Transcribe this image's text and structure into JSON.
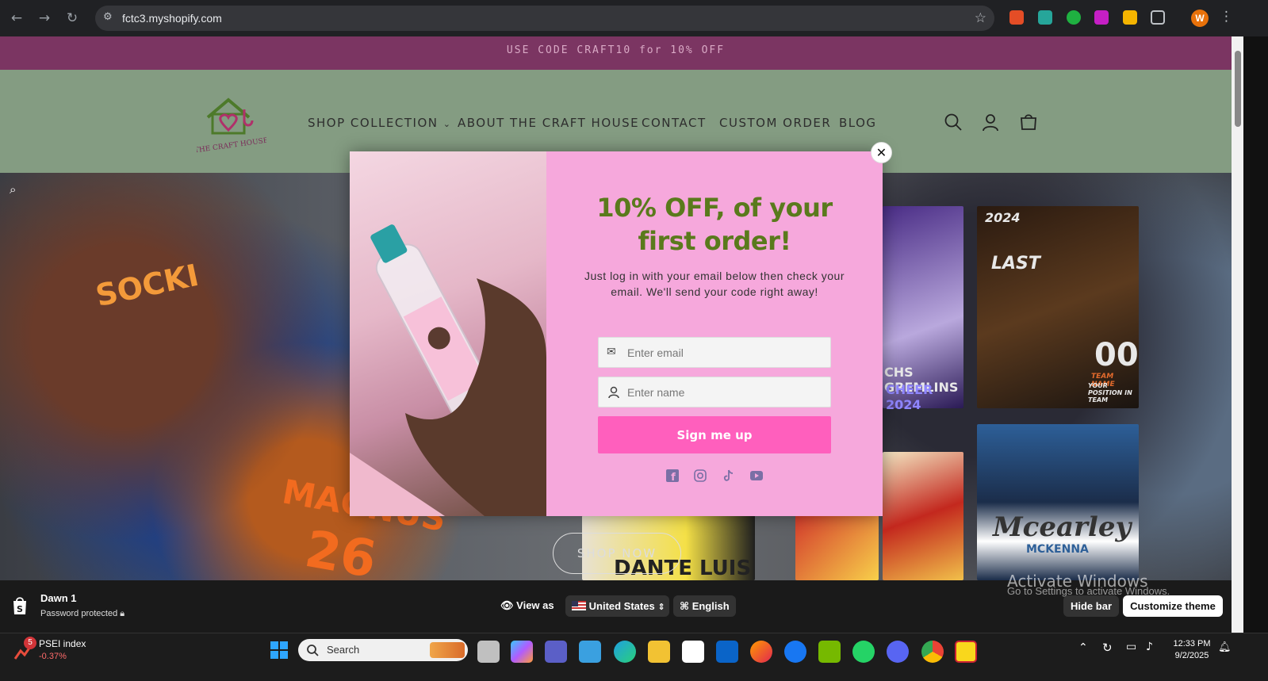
{
  "browser": {
    "url": "fctc3.myshopify.com",
    "profile_initial": "W"
  },
  "announcement": {
    "text": "USE CODE CRAFT10 for 10% OFF"
  },
  "header": {
    "logo_text": "THE CRAFT HOUSE",
    "nav": [
      {
        "label": "SHOP COLLECTION",
        "has_dropdown": true
      },
      {
        "label": "ABOUT THE CRAFT HOUSE"
      },
      {
        "label": "CONTACT"
      },
      {
        "label": "CUSTOM ORDER"
      },
      {
        "label": "BLOG"
      }
    ]
  },
  "hero": {
    "button_label": "SHOP NOW",
    "poster_texts": [
      "2024",
      "LAST",
      "00",
      "TEAM NAME",
      "YOUR POSITION IN TEAM",
      "CHS GREMLINS",
      "CHEER 2024",
      "Mcearley",
      "MCKENNA",
      "DANTE LUIS",
      "MAGNUS",
      "26",
      "SOCKI"
    ]
  },
  "popup": {
    "title": "10% OFF, of your first order!",
    "body": "Just log in with your email below then check your email. We'll send your code right away!",
    "email_placeholder": "Enter email",
    "name_placeholder": "Enter name",
    "submit_label": "Sign me up",
    "close_symbol": "✕",
    "socials": [
      "facebook-icon",
      "instagram-icon",
      "tiktok-icon",
      "youtube-icon"
    ],
    "accent_color": "#ff5fbd",
    "title_color": "#5a7a1c"
  },
  "themebar": {
    "theme_name": "Dawn 1",
    "status": "Password protected",
    "view_as": "View as",
    "country": "United States",
    "language": "English",
    "hide_bar": "Hide bar",
    "customize": "Customize theme",
    "watermark_title": "Activate Windows",
    "watermark_sub": "Go to Settings to activate Windows."
  },
  "taskbar": {
    "widget_name": "PSEI index",
    "widget_change": "-0.37%",
    "widget_badge": "5",
    "search_label": "Search",
    "time": "12:33 PM",
    "date": "9/2/2025"
  }
}
